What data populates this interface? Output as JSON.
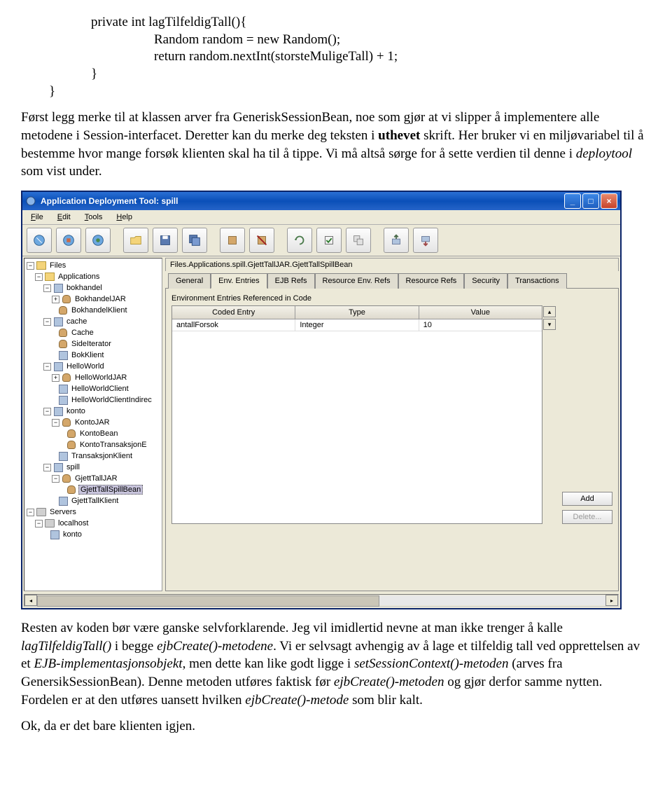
{
  "code": {
    "l1": "private int lagTilfeldigTall(){",
    "l2": "Random random = new Random();",
    "l3": "return random.nextInt(storsteMuligeTall) + 1;",
    "l4": "}",
    "l5": "}"
  },
  "para1_a": "Først legg merke til at klassen arver fra GeneriskSessionBean, noe som gjør at vi slipper å implementere alle metodene i Session-interfacet. Deretter kan du merke deg teksten i ",
  "para1_bold": "uthevet",
  "para1_b": " skrift. Her bruker vi en miljøvariabel til å bestemme hvor mange forsøk klienten skal ha til å tippe. Vi må altså sørge for å sette verdien til denne i ",
  "para1_ital": "deploytool",
  "para1_c": " som vist under.",
  "window": {
    "title": "Application Deployment Tool: spill",
    "menus": {
      "file": "File",
      "edit": "Edit",
      "tools": "Tools",
      "help": "Help"
    }
  },
  "tree": {
    "files": "Files",
    "applications": "Applications",
    "bokhandel": "bokhandel",
    "bokhandelJAR": "BokhandelJAR",
    "bokhandelKlient": "BokhandelKlient",
    "cache": "cache",
    "Cache": "Cache",
    "SideIterator": "SideIterator",
    "BokKlient": "BokKlient",
    "HelloWorld": "HelloWorld",
    "HelloWorldJAR": "HelloWorldJAR",
    "HelloWorldClient": "HelloWorldClient",
    "HelloWorldClientIndirec": "HelloWorldClientIndirec",
    "konto": "konto",
    "KontoJAR": "KontoJAR",
    "KontoBean": "KontoBean",
    "KontoTransaksjonE": "KontoTransaksjonE",
    "TransaksjonKlient": "TransaksjonKlient",
    "spill": "spill",
    "GjettTallJAR": "GjettTallJAR",
    "GjettTallSpillBean": "GjettTallSpillBean",
    "GjettTallKlient": "GjettTallKlient",
    "Servers": "Servers",
    "localhost": "localhost",
    "konto2": "konto"
  },
  "breadcrumb": "Files.Applications.spill.GjettTallJAR.GjettTallSpillBean",
  "tabs": {
    "general": "General",
    "env": "Env. Entries",
    "ejbrefs": "EJB Refs",
    "resenvrefs": "Resource Env. Refs",
    "resrefs": "Resource Refs",
    "security": "Security",
    "transactions": "Transactions"
  },
  "panel": {
    "label": "Environment Entries Referenced in Code",
    "headers": {
      "code": "Coded Entry",
      "type": "Type",
      "value": "Value"
    },
    "row": {
      "code": "antallForsok",
      "type": "Integer",
      "value": "10"
    },
    "add": "Add",
    "delete": "Delete..."
  },
  "para2_a": "Resten av koden bør være ganske selvforklarende. Jeg vil imidlertid nevne at man ikke trenger å kalle ",
  "para2_i1": "lagTilfeldigTall()",
  "para2_b": " i begge ",
  "para2_i2": "ejbCreate()-metodene",
  "para2_c": ". Vi er selvsagt avhengig av å lage et tilfeldig tall ved opprettelsen av et ",
  "para2_i3": "EJB-implementasjonsobjekt",
  "para2_d": ", men dette kan like godt ligge i ",
  "para2_i4": "setSessionContext()-metoden",
  "para2_e": " (arves fra GenersikSessionBean). Denne metoden utføres faktisk før ",
  "para2_i5": "ejbCreate()-metoden",
  "para2_f": " og gjør derfor samme nytten. Fordelen er at den utføres uansett hvilken ",
  "para2_i6": "ejbCreate()-metode",
  "para2_g": " som blir kalt.",
  "para3": "Ok, da er det bare klienten igjen."
}
